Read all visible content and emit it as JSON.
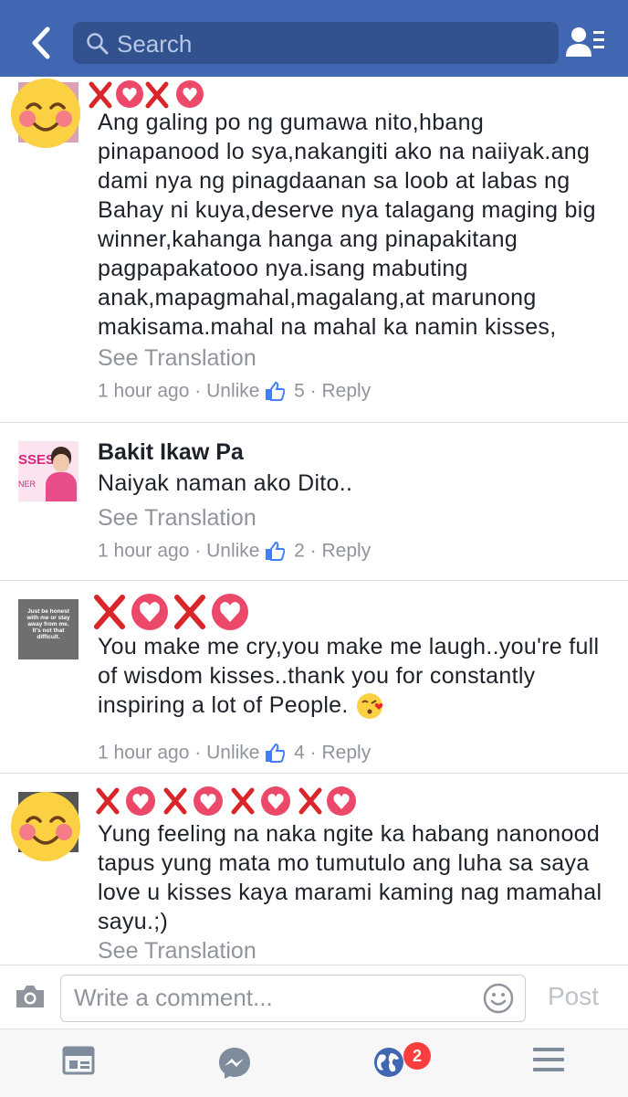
{
  "header": {
    "search_placeholder": "Search"
  },
  "comments": [
    {
      "text": "Ang galing po ng gumawa nito,hbang pinapanood lo sya,nakangiti ako na naiiyak.ang dami nya ng pinagdaanan sa loob at labas ng Bahay ni kuya,deserve nya talagang maging big winner,kahanga hanga ang pinapakitang pagpapakatooo nya.isang mabuting anak,mapagmahal,magalang,at marunong makisama.mahal na mahal ka namin kisses,",
      "see_translation": "See Translation",
      "time": "1 hour ago",
      "action": "Unlike",
      "likes": "5",
      "reply": "Reply"
    },
    {
      "name": "Bakit Ikaw Pa",
      "avatar_text": "SSES",
      "avatar_text2": "NER",
      "text": "Naiyak naman ako Dito..",
      "see_translation": "See Translation",
      "time": "1 hour ago",
      "action": "Unlike",
      "likes": "2",
      "reply": "Reply"
    },
    {
      "avatar_text": "Just be honest with me or stay away from me. It's not that difficult.",
      "text": "You make me cry,you make me laugh..you're full of wisdom kisses..thank you for constantly inspiring a lot of People.",
      "time": "1 hour ago",
      "action": "Unlike",
      "likes": "4",
      "reply": "Reply"
    },
    {
      "text": "Yung feeling na naka ngite ka habang nanonood tapus yung mata mo tumutulo ang luha sa saya love u kisses kaya marami kaming nag mamahal sayu.;)",
      "see_translation": "See Translation"
    }
  ],
  "composer": {
    "placeholder": "Write a comment...",
    "post_label": "Post"
  },
  "tabbar": {
    "notifications_badge": "2"
  },
  "colors": {
    "brand": "#4267b2",
    "like_blue": "#4080ff",
    "badge_red": "#fa3e3e"
  }
}
